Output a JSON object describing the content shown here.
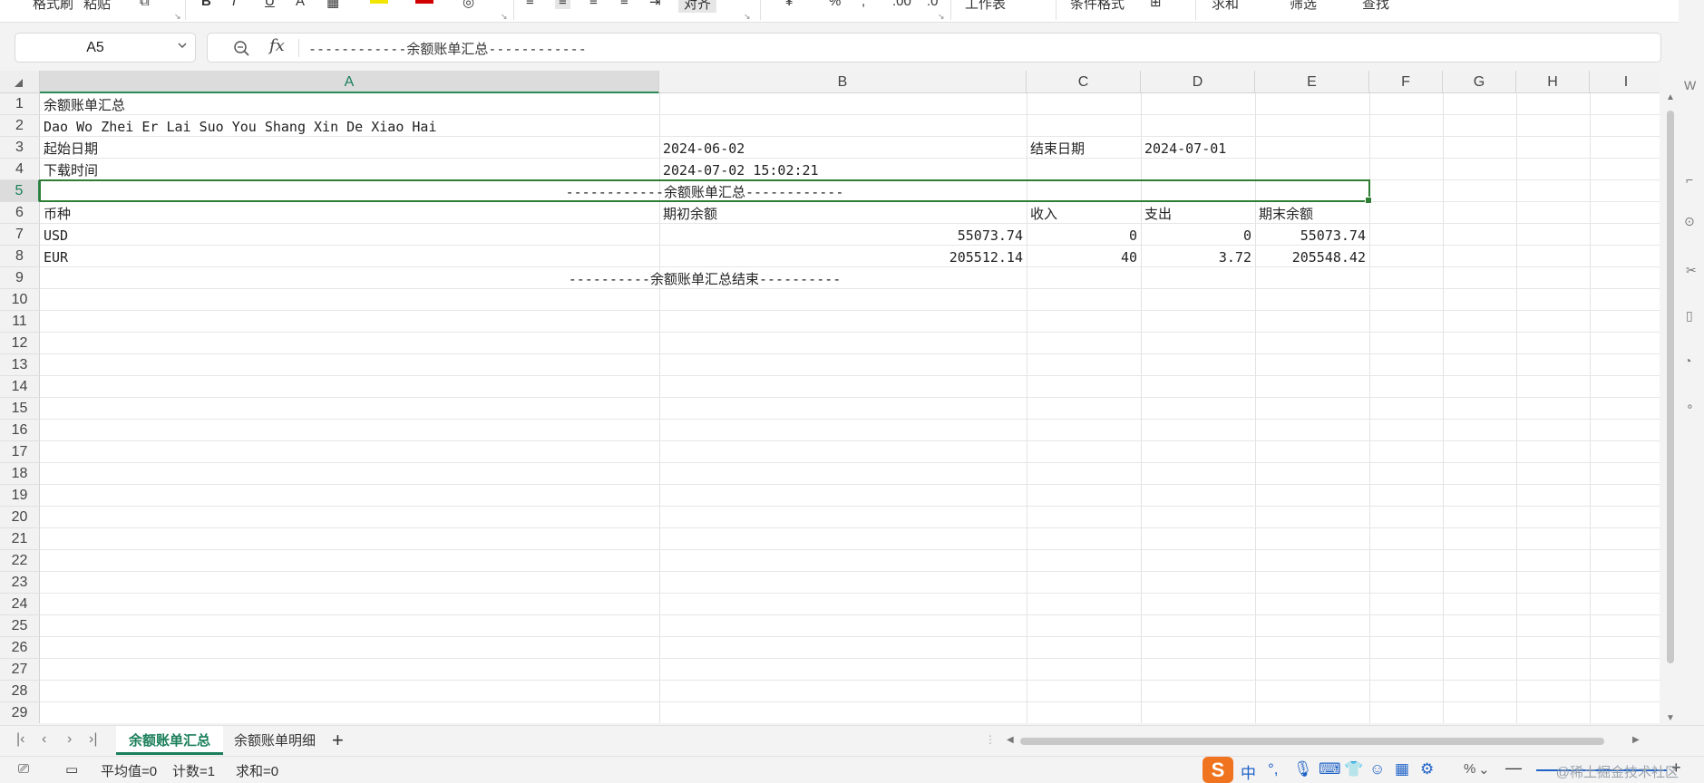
{
  "toolbar": {
    "items": [
      "格式刷",
      "粘贴",
      "B",
      "I",
      "U",
      "A",
      "对齐",
      "%",
      ",",
      "工作表",
      "条件格式",
      "求和",
      "筛选",
      "查找"
    ]
  },
  "name_box": {
    "value": "A5"
  },
  "formula_bar": {
    "fx": "fx",
    "content": "------------余额账单汇总------------"
  },
  "columns": [
    "A",
    "B",
    "C",
    "D",
    "E",
    "F",
    "G",
    "H",
    "I"
  ],
  "selected_column": "A",
  "rows": [
    "1",
    "2",
    "3",
    "4",
    "5",
    "6",
    "7",
    "8",
    "9",
    "10",
    "11",
    "12",
    "13",
    "14",
    "15",
    "16",
    "17",
    "18",
    "19",
    "20",
    "21",
    "22",
    "23",
    "24",
    "25",
    "26",
    "27",
    "28",
    "29"
  ],
  "selected_row": "5",
  "cells": {
    "a1": "余额账单汇总",
    "a2": "Dao Wo Zhei Er Lai Suo You Shang Xin De Xiao Hai",
    "a3": "起始日期",
    "b3": "2024-06-02",
    "c3": "结束日期",
    "d3": "2024-07-01",
    "a4": "下载时间",
    "b4": "2024-07-02 15:02:21",
    "a5": "------------余额账单汇总------------",
    "a6": "币种",
    "b6": "期初余额",
    "c6": "收入",
    "d6": "支出",
    "e6": "期末余额",
    "a7": "USD",
    "b7": "55073.74",
    "c7": "0",
    "d7": "0",
    "e7": "55073.74",
    "a8": "EUR",
    "b8": "205512.14",
    "c8": "40",
    "d8": "3.72",
    "e8": "205548.42",
    "a9": "----------余额账单汇总结束----------"
  },
  "sheet_tabs": [
    "余额账单汇总",
    "余额账单明细"
  ],
  "active_sheet": "余额账单汇总",
  "status": {
    "average": "平均值=0",
    "count": "计数=1",
    "sum": "求和=0"
  },
  "ime": {
    "lang": "中"
  },
  "watermark": "@稀土掘金技术社区",
  "colors": {
    "accent": "#1a7f5a",
    "selection": "#2e7d32",
    "ime": "#f0741f"
  }
}
